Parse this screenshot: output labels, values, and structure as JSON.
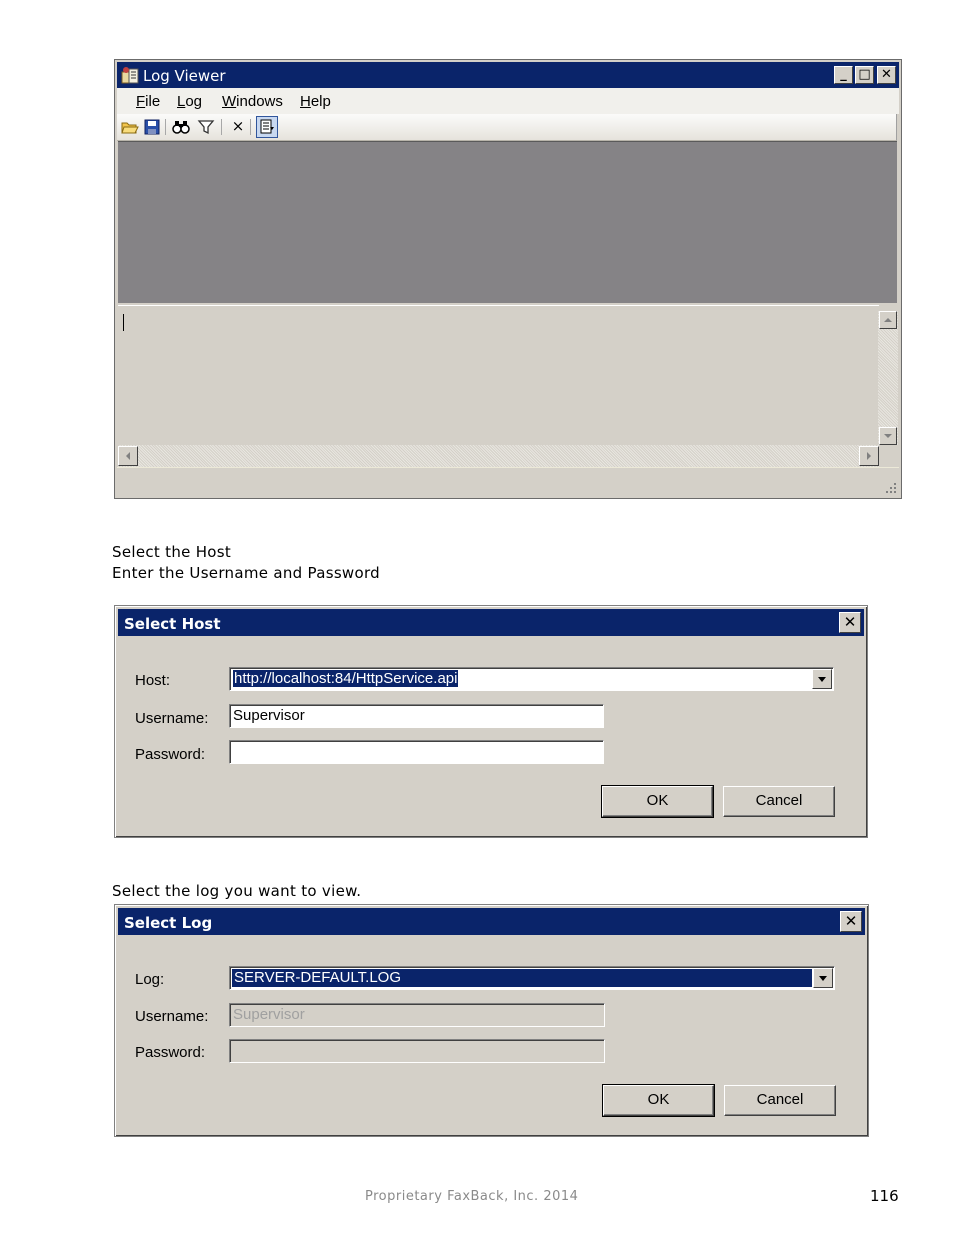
{
  "log_viewer": {
    "title": "Log Viewer",
    "controls": {
      "minimize": "_",
      "maximize": "□",
      "close": "✕"
    },
    "menu": [
      {
        "label": "File",
        "key": "F",
        "rest": "ile"
      },
      {
        "label": "Log",
        "key": "L",
        "rest": "og"
      },
      {
        "label": "Windows",
        "key": "W",
        "rest": "indows"
      },
      {
        "label": "Help",
        "key": "H",
        "rest": "elp"
      }
    ],
    "toolbar_icons": [
      "open-folder-icon",
      "save-icon",
      "find-icon",
      "filter-icon",
      "clear-icon",
      "connect-icon"
    ],
    "toolbar_clear_glyph": "×"
  },
  "captions": {
    "select_host": "Select the Host",
    "enter_credentials": "Enter the Username and Password",
    "select_log": "Select the log you want to view."
  },
  "select_host_dialog": {
    "title": "Select Host",
    "close": "✕",
    "host_label": "Host:",
    "host_value": "http://localhost:84/HttpService.api",
    "username_label": "Username:",
    "username_value": "Supervisor",
    "password_label": "Password:",
    "password_value": "",
    "ok_label": "OK",
    "cancel_label": "Cancel"
  },
  "select_log_dialog": {
    "title": "Select Log",
    "close": "✕",
    "log_label": "Log:",
    "log_value": "SERVER-DEFAULT.LOG",
    "username_label": "Username:",
    "username_value": "Supervisor",
    "password_label": "Password:",
    "password_value": "",
    "ok_label": "OK",
    "cancel_label": "Cancel"
  },
  "footer": {
    "text": "Proprietary FaxBack, Inc. 2014",
    "page_number": "116"
  },
  "colors": {
    "title_bar": "#0a246a",
    "window_face": "#d4d0c8",
    "workspace": "#858386"
  }
}
